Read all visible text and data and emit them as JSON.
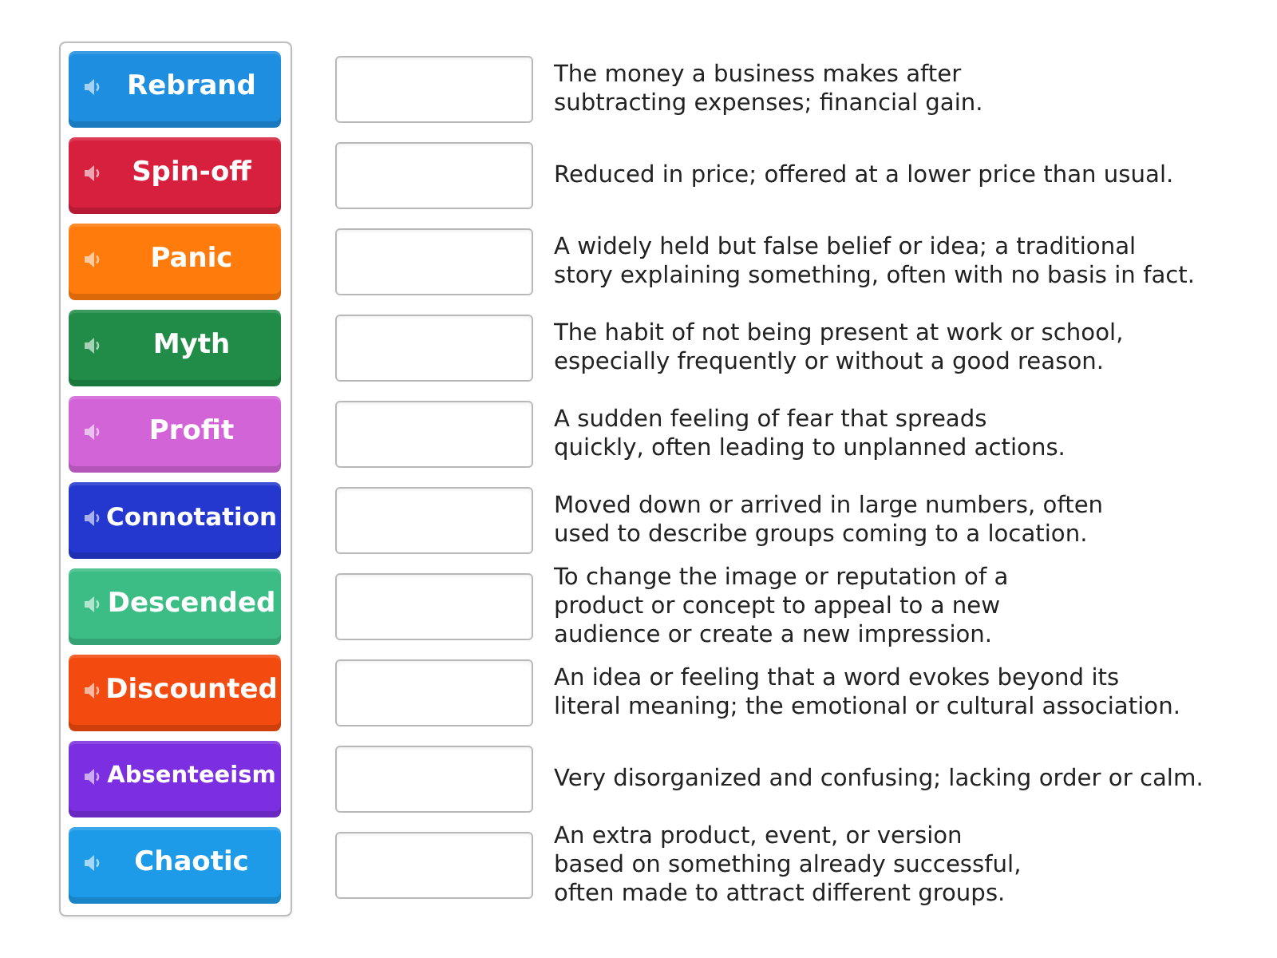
{
  "terms": [
    {
      "label": "Rebrand",
      "color": "#1e8fe0"
    },
    {
      "label": "Spin-off",
      "color": "#d6203d"
    },
    {
      "label": "Panic",
      "color": "#ff7b0c"
    },
    {
      "label": "Myth",
      "color": "#208c47"
    },
    {
      "label": "Profit",
      "color": "#d264d8"
    },
    {
      "label": "Connotation",
      "color": "#2438cf"
    },
    {
      "label": "Descended",
      "color": "#3dbd86"
    },
    {
      "label": "Discounted",
      "color": "#f24a0f"
    },
    {
      "label": "Absenteeism",
      "color": "#7b2fe0"
    },
    {
      "label": "Chaotic",
      "color": "#1e9be8"
    }
  ],
  "definitions": [
    {
      "text": "The money a business makes after\nsubtracting expenses; financial gain."
    },
    {
      "text": "Reduced in price; offered at a lower price than usual."
    },
    {
      "text": "A widely held but false belief or idea; a traditional\nstory explaining something, often with no basis in fact."
    },
    {
      "text": "The habit of not being present at work or school,\nespecially frequently or without a good reason."
    },
    {
      "text": "A sudden feeling of fear that spreads\nquickly, often leading to unplanned actions."
    },
    {
      "text": "Moved down or arrived in large numbers, often\nused to describe groups coming to a location."
    },
    {
      "text": "To change the image or reputation of a\nproduct or concept to appeal to a new\naudience or create a new impression."
    },
    {
      "text": "An idea or feeling that a word evokes beyond its\nliteral meaning; the emotional or cultural association."
    },
    {
      "text": "Very disorganized and confusing; lacking order or calm."
    },
    {
      "text": "An extra product, event, or version\nbased on something already successful,\noften made to attract different groups."
    }
  ]
}
